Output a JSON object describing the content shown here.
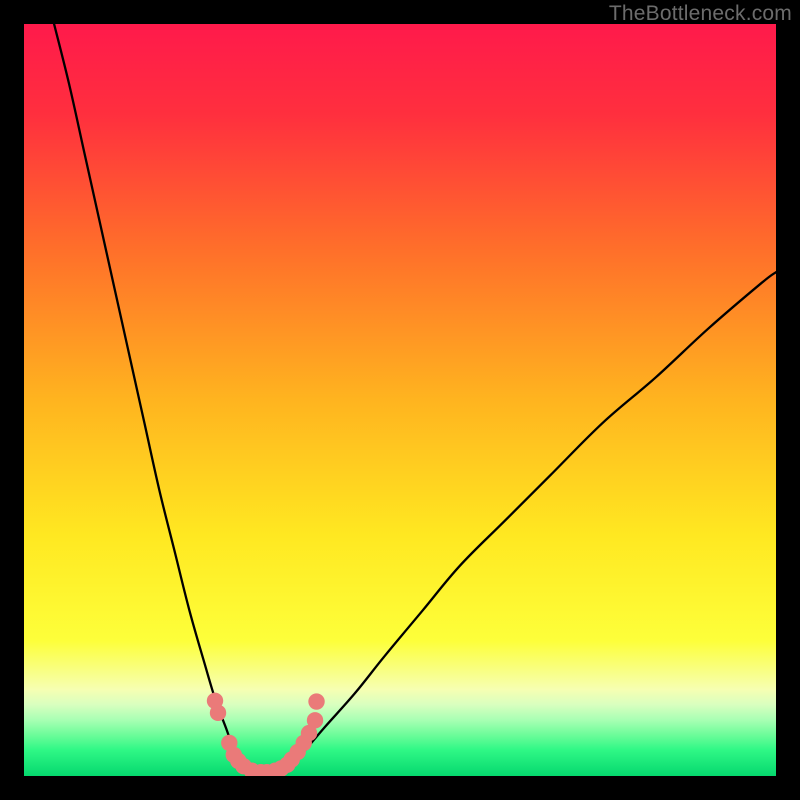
{
  "watermark": "TheBottleneck.com",
  "chart_data": {
    "type": "line",
    "title": "",
    "xlabel": "",
    "ylabel": "",
    "xlim": [
      0,
      100
    ],
    "ylim": [
      0,
      100
    ],
    "background_gradient": {
      "stops": [
        {
          "offset": 0.0,
          "color": "#ff1a4b"
        },
        {
          "offset": 0.12,
          "color": "#ff2f3e"
        },
        {
          "offset": 0.3,
          "color": "#ff6f2a"
        },
        {
          "offset": 0.5,
          "color": "#ffb41f"
        },
        {
          "offset": 0.68,
          "color": "#ffe821"
        },
        {
          "offset": 0.82,
          "color": "#fdff3a"
        },
        {
          "offset": 0.885,
          "color": "#f6ffb2"
        },
        {
          "offset": 0.905,
          "color": "#d9ffbf"
        },
        {
          "offset": 0.925,
          "color": "#a9ffb4"
        },
        {
          "offset": 0.945,
          "color": "#6efc9a"
        },
        {
          "offset": 0.965,
          "color": "#30f886"
        },
        {
          "offset": 1.0,
          "color": "#05d86e"
        }
      ]
    },
    "series": [
      {
        "name": "left-branch",
        "type": "line",
        "color": "#000000",
        "x": [
          4.0,
          6.0,
          8.0,
          10.0,
          12.0,
          14.0,
          16.0,
          18.0,
          20.0,
          22.0,
          24.0,
          25.5,
          27.0,
          28.0,
          28.7
        ],
        "y": [
          100.0,
          92.0,
          83.0,
          74.0,
          65.0,
          56.0,
          47.0,
          38.0,
          30.0,
          22.0,
          15.0,
          10.0,
          6.0,
          3.0,
          1.2
        ]
      },
      {
        "name": "valley-floor",
        "type": "line",
        "color": "#000000",
        "x": [
          28.7,
          30.0,
          32.0,
          34.0,
          35.3
        ],
        "y": [
          1.2,
          0.4,
          0.0,
          0.4,
          1.2
        ]
      },
      {
        "name": "right-branch",
        "type": "line",
        "color": "#000000",
        "x": [
          35.3,
          37.0,
          40.0,
          44.0,
          48.0,
          53.0,
          58.0,
          64.0,
          70.0,
          77.0,
          84.0,
          91.0,
          98.0,
          100.0
        ],
        "y": [
          1.2,
          3.0,
          6.5,
          11.0,
          16.0,
          22.0,
          28.0,
          34.0,
          40.0,
          47.0,
          53.0,
          59.5,
          65.5,
          67.0
        ]
      },
      {
        "name": "left-marker-cluster",
        "type": "scatter",
        "color": "#ea7a79",
        "x": [
          25.4,
          25.8,
          27.3,
          27.9,
          28.5,
          29.2,
          30.3,
          31.5
        ],
        "y": [
          10.0,
          8.4,
          4.4,
          2.8,
          2.0,
          1.3,
          0.7,
          0.5
        ]
      },
      {
        "name": "right-marker-cluster",
        "type": "scatter",
        "color": "#ea7a79",
        "x": [
          32.3,
          33.4,
          34.2,
          35.0,
          35.6,
          36.4,
          37.2,
          37.9,
          38.7,
          38.9
        ],
        "y": [
          0.5,
          0.7,
          1.0,
          1.5,
          2.2,
          3.2,
          4.4,
          5.7,
          7.4,
          9.9
        ]
      }
    ]
  }
}
